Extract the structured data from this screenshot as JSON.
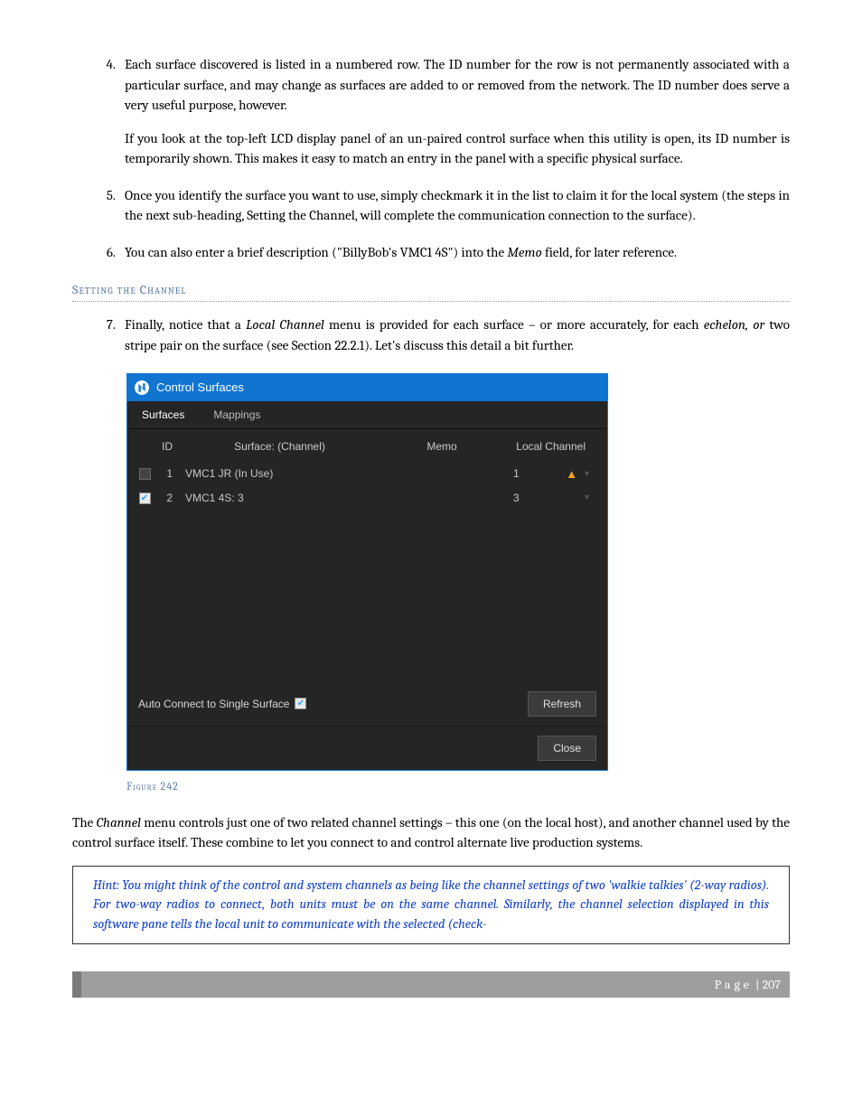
{
  "listItems": {
    "4": {
      "num": "4.",
      "p1": "Each surface discovered is listed in a numbered row.  The ID number for the row is not permanently associated with a particular surface, and may change as surfaces are added to or removed from the network. The ID number does serve a very useful purpose, however.",
      "p2": "If you look at the top-left LCD display panel of an un-paired control surface when this utility is open, its ID number is temporarily shown.  This makes it easy to match an entry in the panel with a specific physical surface."
    },
    "5": {
      "num": "5.",
      "p1": "Once you identify the surface you want to use, simply checkmark it in the list to claim it for the local system (the steps in the next sub-heading, Setting the Channel, will complete the communication connection to the surface)."
    },
    "6": {
      "num": "6.",
      "p1a": "You can also enter a brief description (\"BillyBob's VMC1 4S\") into the ",
      "memo": "Memo",
      "p1b": " field, for later reference."
    },
    "7": {
      "num": "7.",
      "p1a": "Finally, notice that a ",
      "lc": "Local Channel",
      "p1b": " menu is provided for each surface – or more accurately, for each ",
      "ech": "echelon, or",
      "p1c": " two stripe pair on the surface (see Section 22.2.1).  Let's discuss this detail a bit further."
    }
  },
  "sectionHeading": "Setting the Channel",
  "dialog": {
    "title": "Control Surfaces",
    "tabs": {
      "surfaces": "Surfaces",
      "mappings": "Mappings"
    },
    "columns": {
      "id": "ID",
      "surface": "Surface: (Channel)",
      "memo": "Memo",
      "localChannel": "Local Channel"
    },
    "rows": [
      {
        "checked": false,
        "id": "1",
        "surface": "VMC1 JR (In Use)",
        "memo": "",
        "channel": "1",
        "warn": true
      },
      {
        "checked": true,
        "id": "2",
        "surface": "VMC1 4S: 3",
        "memo": "",
        "channel": "3",
        "warn": false
      }
    ],
    "autoConnect": "Auto Connect to Single Surface",
    "refresh": "Refresh",
    "close": "Close"
  },
  "figureCaption": "Figure 242",
  "paraAfter": {
    "a": "The ",
    "ch": "Channel",
    "b": " menu controls just one of two related channel settings – this one (on the local host), and another channel used by the control surface itself.  These combine to let you connect to and control alternate live production systems."
  },
  "hint": "Hint: You might think of the control and system channels as being like the channel settings of two 'walkie talkies' (2-way radios).  For two-way radios to connect, both units must be on the same channel.  Similarly, the channel selection displayed in this software pane tells the local unit to communicate with the selected (check-",
  "footer": {
    "label": "Page",
    "sep": " | ",
    "num": "207"
  }
}
